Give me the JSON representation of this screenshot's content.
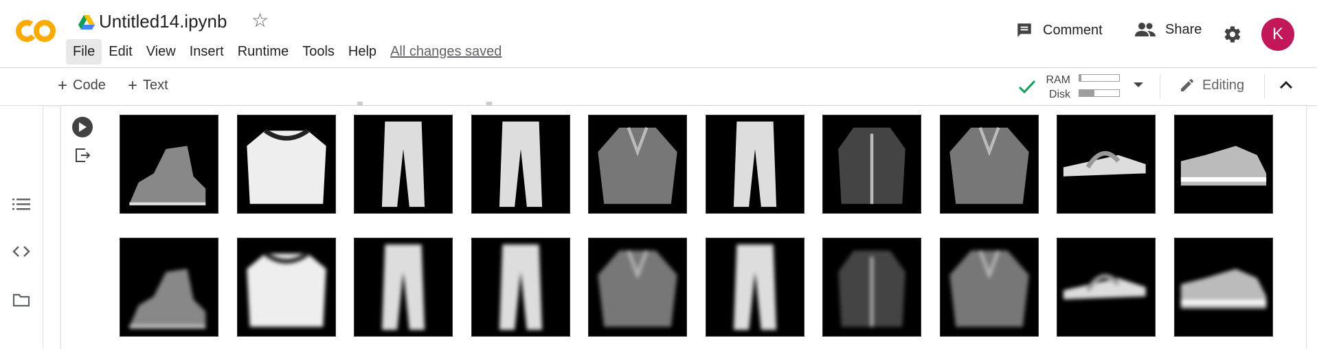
{
  "app": {
    "file_name": "Untitled14.ipynb",
    "logo_text": "CO"
  },
  "menu": {
    "items": [
      {
        "label": "File",
        "active": true
      },
      {
        "label": "Edit"
      },
      {
        "label": "View"
      },
      {
        "label": "Insert"
      },
      {
        "label": "Runtime"
      },
      {
        "label": "Tools"
      },
      {
        "label": "Help"
      }
    ],
    "status": "All changes saved"
  },
  "header_actions": {
    "comment": "Comment",
    "share": "Share",
    "avatar_initial": "K"
  },
  "toolbar": {
    "code": "Code",
    "text": "Text",
    "ram_label": "RAM",
    "disk_label": "Disk",
    "ram_usage": 0.05,
    "disk_usage": 0.38,
    "editing": "Editing"
  },
  "icons": {
    "star": "star-icon",
    "comment": "comment-icon",
    "share": "people-icon",
    "settings": "gear-icon",
    "toc": "list-icon",
    "snippets": "code-icon",
    "files": "folder-icon",
    "run": "play-icon",
    "output": "output-icon",
    "status": "check-icon",
    "edit": "pencil-icon",
    "collapse": "chevron-up-icon"
  },
  "colors": {
    "accent_orange": "#F9AB00",
    "logo_light": "#FBBC04",
    "avatar": "#C2185B",
    "check": "#0F9D58"
  },
  "output_images": {
    "original": [
      "ankle-boot",
      "pullover",
      "trouser",
      "trouser",
      "shirt",
      "trouser",
      "coat",
      "shirt",
      "sandal",
      "sneaker"
    ],
    "reconstructed": [
      "ankle-boot",
      "pullover",
      "trouser",
      "trouser",
      "shirt",
      "trouser",
      "coat",
      "shirt",
      "sandal",
      "sneaker"
    ]
  }
}
